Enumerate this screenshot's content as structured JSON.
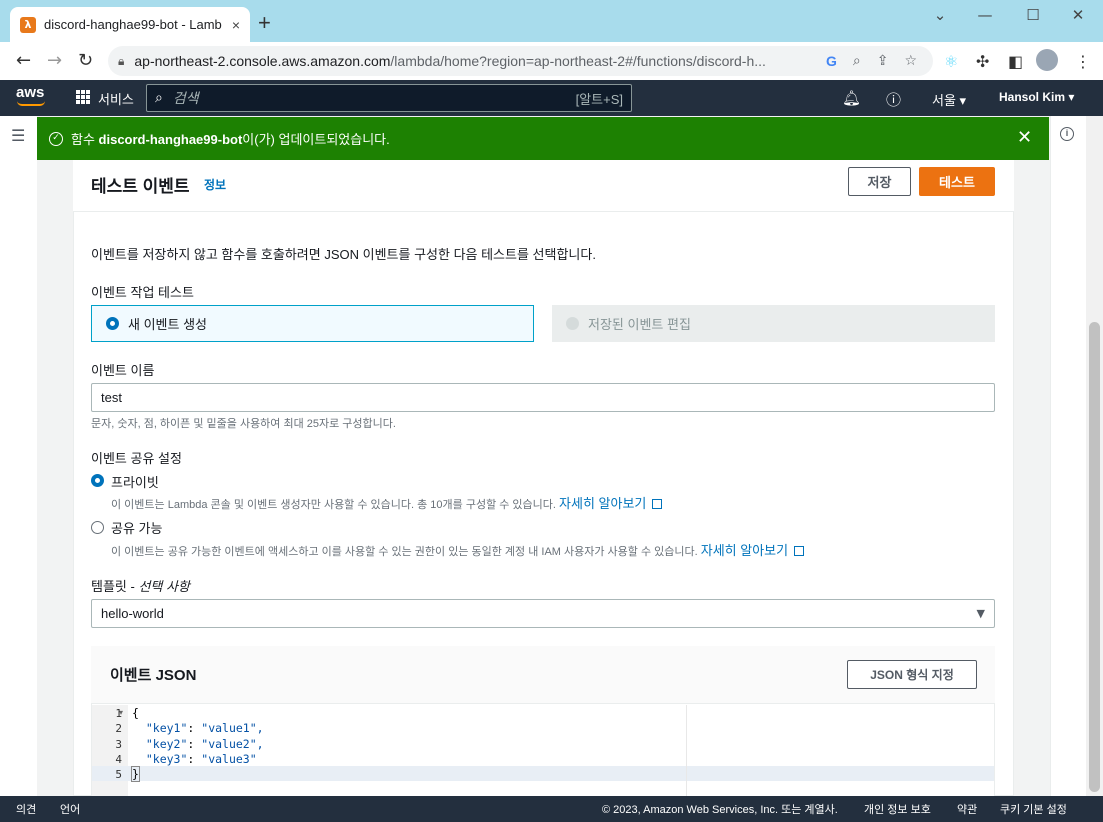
{
  "browser": {
    "tab_title": "discord-hanghae99-bot - Lamb",
    "favicon": "λ",
    "tab_close": "×",
    "new_tab": "+",
    "window_controls": {
      "minimize": "⌄",
      "restore": "—",
      "maximize": "☐",
      "close": "✕"
    },
    "url_host": "ap-northeast-2.console.aws.amazon.com",
    "url_path": "/lambda/home?region=ap-northeast-2#/functions/discord-h...",
    "google_label": "G"
  },
  "aws_nav": {
    "logo": "aws",
    "services_label": "서비스",
    "search_placeholder": "검색",
    "search_shortcut": "[알트+S]",
    "region_label": "서울 ▾",
    "user_label": "Hansol Kim ▾"
  },
  "flash": {
    "prefix": "함수 ",
    "function_name": "discord-hanghae99-bot",
    "suffix": "이(가) 업데이트되었습니다."
  },
  "panel": {
    "title": "테스트 이벤트",
    "info_link": "정보",
    "save_button": "저장",
    "test_button": "테스트",
    "description": "이벤트를 저장하지 않고 함수를 호출하려면 JSON 이벤트를 구성한 다음 테스트를 선택합니다.",
    "action_label": "이벤트 작업 테스트",
    "action_new": "새 이벤트 생성",
    "action_edit": "저장된 이벤트 편집",
    "name_label": "이벤트 이름",
    "name_value": "test",
    "name_hint": "문자, 숫자, 점, 하이픈 및 밑줄을 사용하여 최대 25자로 구성합니다.",
    "sharing_label": "이벤트 공유 설정",
    "private_label": "프라이빗",
    "private_desc": "이 이벤트는 Lambda 콘솔 및 이벤트 생성자만 사용할 수 있습니다. 총 10개를 구성할 수 있습니다.",
    "shareable_label": "공유 가능",
    "shareable_desc": "이 이벤트는 공유 가능한 이벤트에 액세스하고 이를 사용할 수 있는 권한이 있는 동일한 계정 내 IAM 사용자가 사용할 수 있습니다.",
    "learn_more": "자세히 알아보기",
    "template_label": "템플릿 - ",
    "template_optional": "선택 사항",
    "template_value": "hello-world",
    "json_title": "이벤트 JSON",
    "format_button": "JSON 형식 지정"
  },
  "editor": {
    "line_numbers": [
      "1",
      "2",
      "3",
      "4",
      "5"
    ],
    "lines": [
      {
        "text": "{"
      },
      {
        "key": "\"key1\"",
        "value": "\"value1\","
      },
      {
        "key": "\"key2\"",
        "value": "\"value2\","
      },
      {
        "key": "\"key3\"",
        "value": "\"value3\""
      },
      {
        "text": "}"
      }
    ]
  },
  "footer": {
    "feedback": "의견",
    "language": "언어",
    "copyright": "© 2023, Amazon Web Services, Inc. 또는 계열사.",
    "privacy": "개인 정보 보호",
    "terms": "약관",
    "cookies": "쿠키 기본 설정"
  },
  "colors": {
    "aws_nav": "#232f3e",
    "flash_success": "#1d8102",
    "primary_button": "#ec7211",
    "link": "#0073bb"
  }
}
